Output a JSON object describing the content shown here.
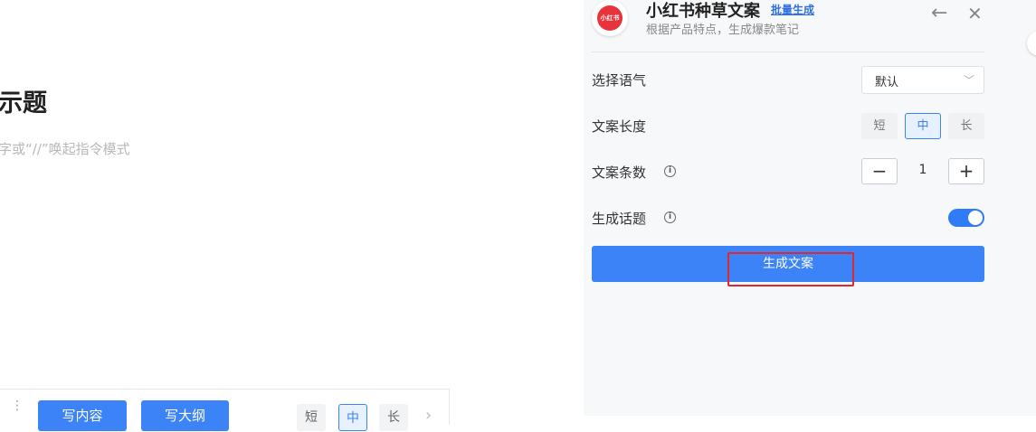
{
  "editor": {
    "title": "示题",
    "hint": "字或“//”唤起指令模式",
    "toolbar": {
      "write_content": "写内容",
      "write_outline": "写大纲",
      "length_short": "短",
      "length_medium": "中",
      "length_long": "长"
    }
  },
  "panel": {
    "logo_text": "小红书",
    "title": "小红书种草文案",
    "batch_link": "批量生成",
    "subtitle": "根据产品特点，生成爆款笔记",
    "tone": {
      "label": "选择语气",
      "selected": "默认"
    },
    "length": {
      "label": "文案长度",
      "options": [
        "短",
        "中",
        "长"
      ],
      "selected": "中"
    },
    "count": {
      "label": "文案条数",
      "value": "1"
    },
    "topics": {
      "label": "生成话题",
      "enabled": true
    },
    "generate_button": "生成文案"
  },
  "colors": {
    "accent": "#3b83f6",
    "highlight": "#e0282e",
    "logo": "#e8323c"
  }
}
